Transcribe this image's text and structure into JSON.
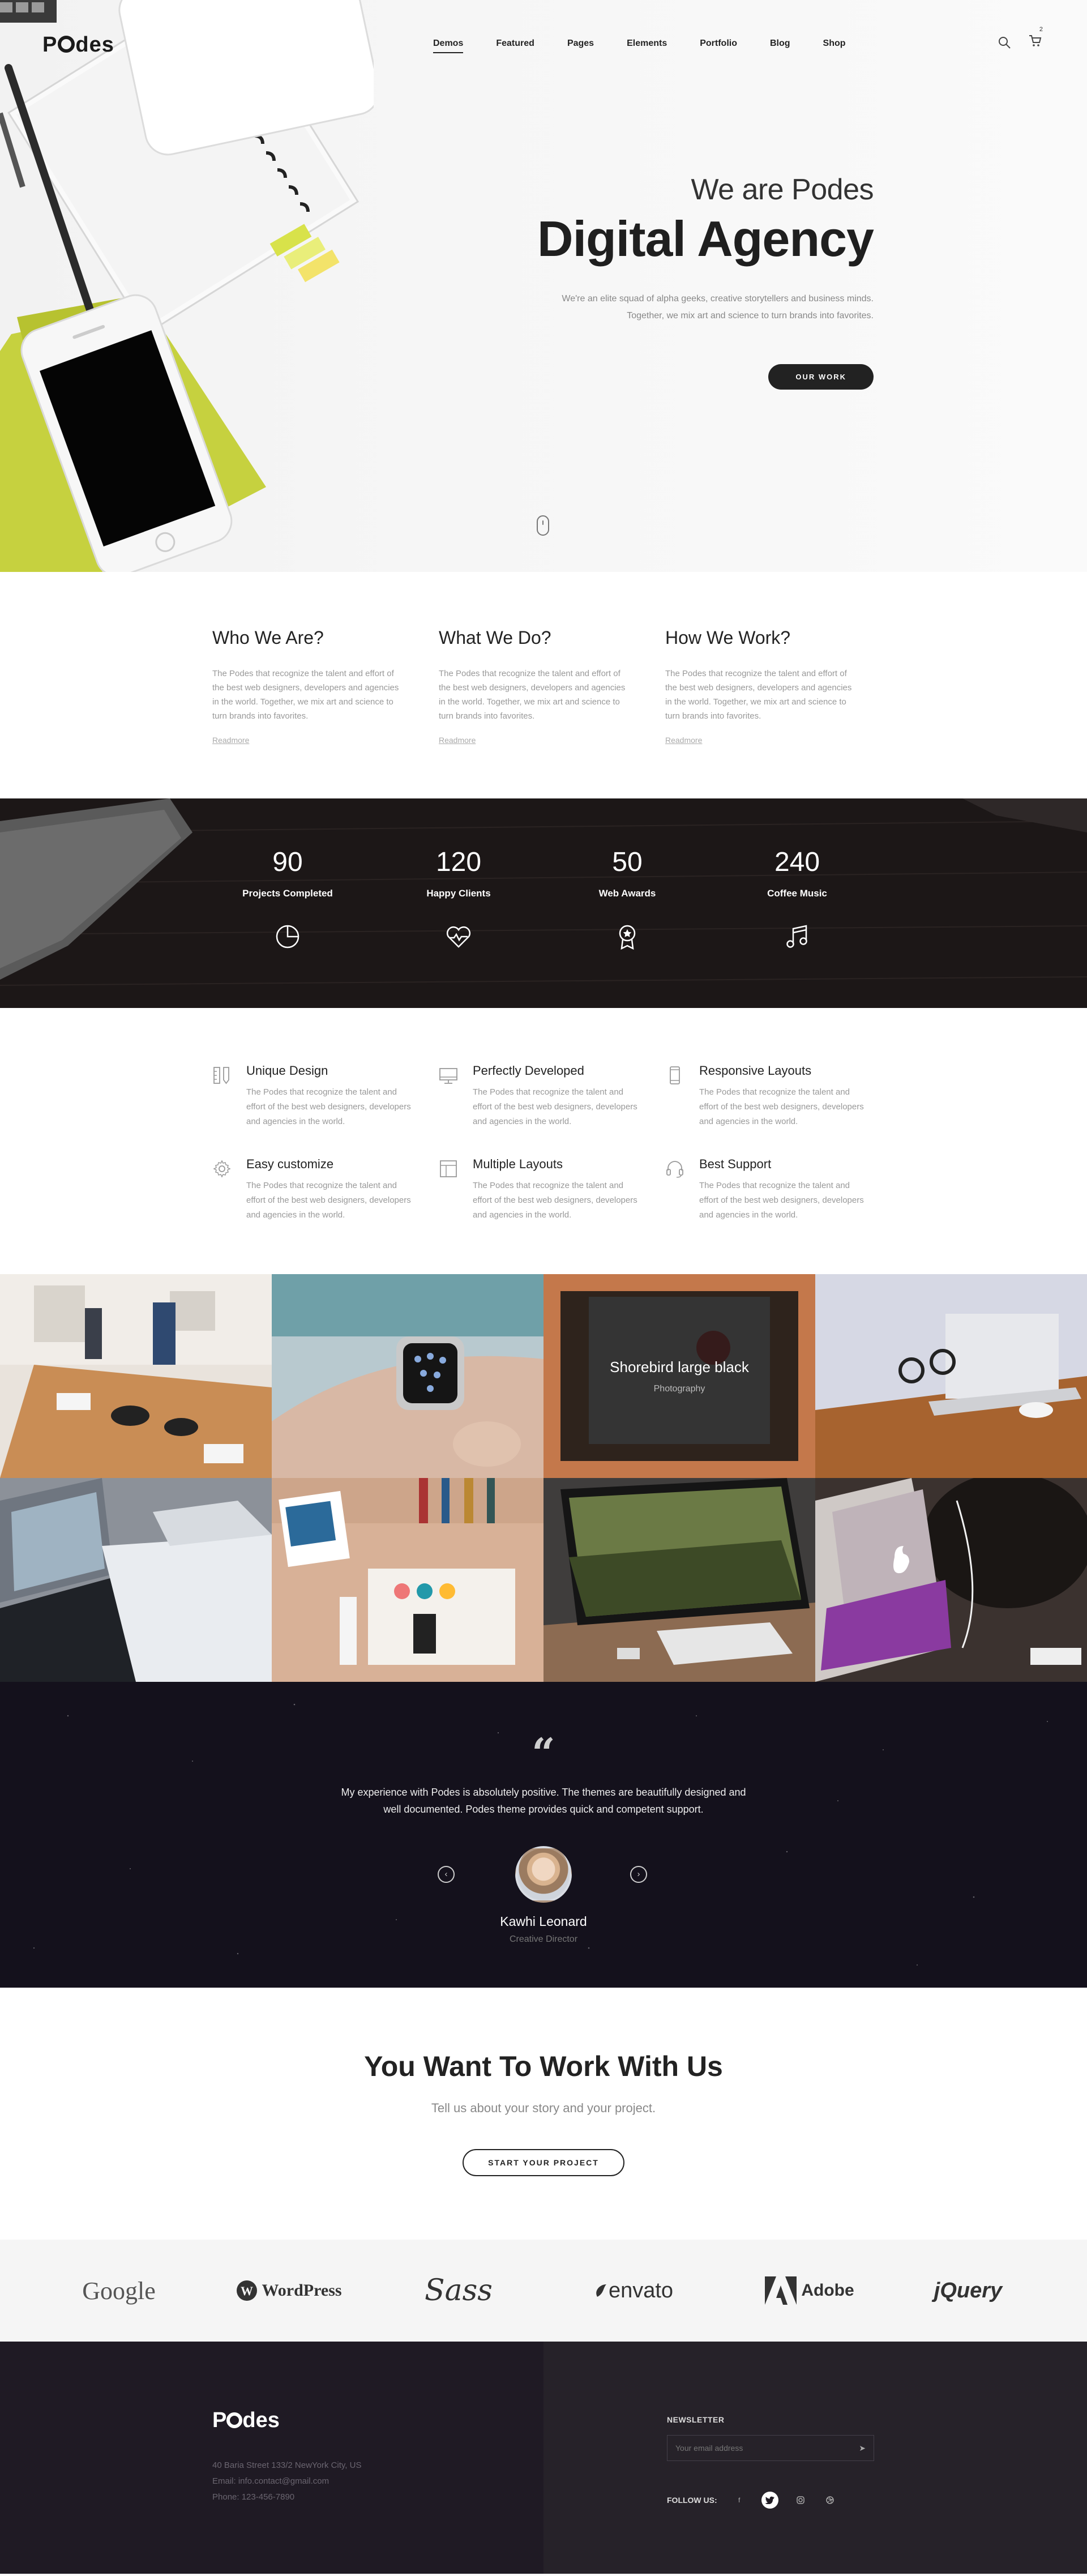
{
  "brand": {
    "name_prefix": "P",
    "name_suffix": "des"
  },
  "nav": [
    "Demos",
    "Featured",
    "Pages",
    "Elements",
    "Portfolio",
    "Blog",
    "Shop"
  ],
  "cart_count": "2",
  "hero": {
    "subtitle": "We are Podes",
    "title": "Digital Agency",
    "desc_line1": "We're an elite squad of alpha geeks, creative storytellers and business minds.",
    "desc_line2": "Together, we mix art and science to turn brands into favorites.",
    "button": "OUR WORK"
  },
  "about": [
    {
      "title": "Who We Are?",
      "text": "The Podes that recognize the talent and effort of the best web designers, developers and agencies in the world. Together, we mix art and science to turn brands into favorites.",
      "link": "Readmore"
    },
    {
      "title": "What We Do?",
      "text": "The Podes that recognize the talent and effort of the best web designers, developers and agencies in the world. Together, we mix art and science to turn brands into favorites.",
      "link": "Readmore"
    },
    {
      "title": "How We Work?",
      "text": "The Podes that recognize the talent and effort of the best web designers, developers and agencies in the world. Together, we mix art and science to turn brands into favorites.",
      "link": "Readmore"
    }
  ],
  "stats": [
    {
      "value": "90",
      "label": "Projects Completed",
      "icon": "pie-chart-icon"
    },
    {
      "value": "120",
      "label": "Happy Clients",
      "icon": "heart-pulse-icon"
    },
    {
      "value": "50",
      "label": "Web Awards",
      "icon": "award-icon"
    },
    {
      "value": "240",
      "label": "Coffee Music",
      "icon": "music-note-icon"
    }
  ],
  "features": [
    {
      "title": "Unique Design",
      "text": "The Podes that recognize the talent and effort of the best web designers, developers and agencies in the world.",
      "icon": "pencil-ruler-icon"
    },
    {
      "title": "Perfectly Developed",
      "text": "The Podes that recognize the talent and effort of the best web designers, developers and agencies in the world.",
      "icon": "monitor-icon"
    },
    {
      "title": "Responsive Layouts",
      "text": "The Podes that recognize the talent and effort of the best web designers, developers and agencies in the world.",
      "icon": "mobile-icon"
    },
    {
      "title": "Easy customize",
      "text": "The Podes that recognize the talent and effort of the best web designers, developers and agencies in the world.",
      "icon": "gear-icon"
    },
    {
      "title": "Multiple Layouts",
      "text": "The Podes that recognize the talent and effort of the best web designers, developers and agencies in the world.",
      "icon": "layout-icon"
    },
    {
      "title": "Best Support",
      "text": "The Podes that recognize the talent and effort of the best web designers, developers and agencies in the world.",
      "icon": "headset-icon"
    }
  ],
  "portfolio_overlay": {
    "title": "Shorebird large black",
    "category": "Photography"
  },
  "testimonial": {
    "quote_line1": "My experience with Podes is absolutely positive. The themes are beautifully designed and",
    "quote_line2": "well documented. Podes theme provides quick and competent support.",
    "name": "Kawhi Leonard",
    "role": "Creative Director"
  },
  "cta": {
    "title": "You Want To Work With Us",
    "subtitle": "Tell us about your story and your project.",
    "button": "START YOUR PROJECT"
  },
  "clients": [
    "Google",
    "WordPress",
    "Sass",
    "envato",
    "Adobe",
    "jQuery"
  ],
  "footer": {
    "address": "40 Baria Street 133/2 NewYork City, US",
    "email": "Email: info.contact@gmail.com",
    "phone": "Phone: 123-456-7890",
    "newsletter_title": "NEWSLETTER",
    "newsletter_placeholder": "Your email address",
    "follow_label": "FOLLOW US:"
  },
  "colors": {
    "dark": "#222222",
    "footer_left": "#1f1a24",
    "footer_right": "#262229",
    "lime": "#c9d64a"
  }
}
